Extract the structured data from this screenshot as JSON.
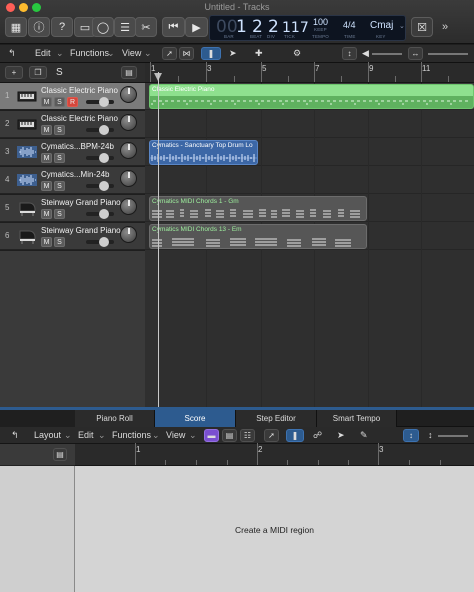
{
  "window": {
    "title": "Untitled - Tracks",
    "traffic_lights": [
      "#ff5f57",
      "#febc2e",
      "#28c840"
    ]
  },
  "lcd": {
    "bar": "1",
    "beat": "2",
    "div": "2",
    "tick": "117",
    "tempo": "100",
    "keep": "KEEP",
    "time_sig": "4/4",
    "key": "Cmaj",
    "labels": {
      "bar": "BAR",
      "beat": "BEAT",
      "div": "DIV",
      "tick": "TICK",
      "tempo": "TEMPO",
      "time": "TIME",
      "key": "KEY"
    }
  },
  "track_toolbar": {
    "edit_label": "Edit",
    "functions_label": "Functions",
    "view_label": "View"
  },
  "ruler": {
    "bars": [
      "1",
      "3",
      "5",
      "7",
      "9",
      "11"
    ]
  },
  "tracks": [
    {
      "num": "1",
      "name": "Classic Electric Piano",
      "type": "keyboard",
      "selected": true,
      "rec": true
    },
    {
      "num": "2",
      "name": "Classic Electric Piano",
      "type": "keyboard",
      "selected": false,
      "rec": false
    },
    {
      "num": "3",
      "name": "Cymatics...BPM-24b",
      "type": "audio",
      "selected": false,
      "rec": false
    },
    {
      "num": "4",
      "name": "Cymatics...Min-24b",
      "type": "audio",
      "selected": false,
      "rec": false
    },
    {
      "num": "5",
      "name": "Steinway Grand Piano",
      "type": "piano",
      "selected": false,
      "rec": false
    },
    {
      "num": "6",
      "name": "Steinway Grand Piano",
      "type": "piano",
      "selected": false,
      "rec": false
    }
  ],
  "button_labels": {
    "mute": "M",
    "solo": "S",
    "record": "R"
  },
  "regions": [
    {
      "label": "Classic Electric Piano",
      "track": 0,
      "kind": "midi-green"
    },
    {
      "label": "Cymatics - Sanctuary Top Drum Lo",
      "track": 2,
      "kind": "audio-blue"
    },
    {
      "label": "Cymatics MIDI Chords 1 - Gm",
      "track": 4,
      "kind": "midi-gray"
    },
    {
      "label": "Cymatics MIDI Chords 13 - Em",
      "track": 5,
      "kind": "midi-gray"
    }
  ],
  "editor": {
    "tabs": [
      "Piano Roll",
      "Score",
      "Step Editor",
      "Smart Tempo"
    ],
    "active_tab": "Score",
    "layout_label": "Layout",
    "edit_label": "Edit",
    "functions_label": "Functions",
    "view_label": "View",
    "ruler_bars": [
      "1",
      "2",
      "3"
    ],
    "empty_message": "Create a MIDI region"
  },
  "colors": {
    "accent_blue": "#2d5b8f",
    "midi_green": "#8ee08e",
    "audio_blue": "#3c67a6",
    "record_red": "#d5473c"
  }
}
